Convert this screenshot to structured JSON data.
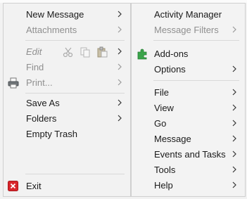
{
  "left_menu": {
    "new_message": "New Message",
    "attachments": "Attachments",
    "edit": "Edit",
    "find": "Find",
    "print": "Print...",
    "save_as": "Save As",
    "folders": "Folders",
    "empty_trash": "Empty Trash",
    "exit": "Exit"
  },
  "right_menu": {
    "activity_manager": "Activity Manager",
    "message_filters": "Message Filters",
    "addons": "Add-ons",
    "options": "Options",
    "file": "File",
    "view": "View",
    "go": "Go",
    "message": "Message",
    "events_and_tasks": "Events and Tasks",
    "tools": "Tools",
    "help": "Help"
  },
  "colors": {
    "menu_bg": "#f2f2f2",
    "disabled_text": "#8f8f8f",
    "exit_icon": "#d9262c",
    "addons_icon": "#3aa44a"
  }
}
